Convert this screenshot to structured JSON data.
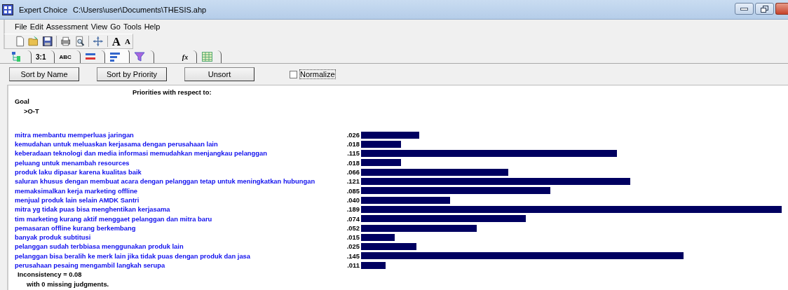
{
  "window": {
    "title": "Expert Choice",
    "path": "C:\\Users\\user\\Documents\\THESIS.ahp"
  },
  "menu": [
    {
      "label": "File"
    },
    {
      "label": "Edit"
    },
    {
      "label": "Assessment"
    },
    {
      "label": "View"
    },
    {
      "label": "Go"
    },
    {
      "label": "Tools"
    },
    {
      "label": "Help"
    }
  ],
  "toolbar": [
    {
      "kind": "new"
    },
    {
      "kind": "open"
    },
    {
      "kind": "save"
    },
    {
      "kind": "sep"
    },
    {
      "kind": "print"
    },
    {
      "kind": "preview"
    },
    {
      "kind": "sep"
    },
    {
      "kind": "move"
    },
    {
      "kind": "sep"
    },
    {
      "kind": "font-up",
      "label": "A"
    },
    {
      "kind": "font-down",
      "label": "A"
    }
  ],
  "tabs": [
    {
      "kind": "tree",
      "selected": false
    },
    {
      "kind": "text",
      "label": "3:1",
      "selected": false
    },
    {
      "kind": "text",
      "label": "ABC",
      "selected": false
    },
    {
      "kind": "bars-red",
      "selected": false
    },
    {
      "kind": "bars",
      "selected": true
    },
    {
      "kind": "funnel",
      "selected": false
    },
    {
      "kind": "gap"
    },
    {
      "kind": "formula",
      "label": "fx",
      "selected": false
    },
    {
      "kind": "grid",
      "selected": false
    }
  ],
  "buttons": [
    {
      "label": "Sort by Name"
    },
    {
      "label": "Sort by Priority"
    },
    {
      "label": "Unsort"
    }
  ],
  "normalize": {
    "label": "Normalize",
    "checked": false
  },
  "report": {
    "heading": "Priorities with respect to:",
    "goal": "Goal",
    "node": ">O-T",
    "items": [
      {
        "label": "mitra membantu memperluas jaringan",
        "value": ".026"
      },
      {
        "label": "kemudahan untuk meluaskan kerjasama dengan perusahaan lain",
        "value": ".018"
      },
      {
        "label": "keberadaan teknologi dan media informasi memudahkan menjangkau pelanggan",
        "value": ".115"
      },
      {
        "label": "peluang untuk menambah resources",
        "value": ".018"
      },
      {
        "label": "produk laku dipasar karena kualitas baik",
        "value": ".066"
      },
      {
        "label": "saluran khusus dengan membuat acara dengan pelanggan tetap untuk meningkatkan hubungan",
        "value": ".121"
      },
      {
        "label": "memaksimalkan kerja marketing offline",
        "value": ".085"
      },
      {
        "label": "menjual produk lain selain AMDK Santri",
        "value": ".040"
      },
      {
        "label": "mitra yg tidak puas bisa menghentikan kerjasama",
        "value": ".189"
      },
      {
        "label": "tim marketing kurang aktif menggaet pelanggan dan mitra baru",
        "value": ".074"
      },
      {
        "label": "pemasaran offline kurang berkembang",
        "value": ".052"
      },
      {
        "label": "banyak produk subtitusi",
        "value": ".015"
      },
      {
        "label": "pelanggan sudah terbbiasa menggunakan produk lain",
        "value": ".025"
      },
      {
        "label": "pelanggan bisa beralih ke merk lain jika tidak puas dengan produk dan jasa",
        "value": ".145"
      },
      {
        "label": "perusahaan pesaing mengambil langkah serupa",
        "value": ".011"
      }
    ],
    "inconsistency": "Inconsistency = 0.08",
    "missing": "with 0  missing judgments."
  }
}
